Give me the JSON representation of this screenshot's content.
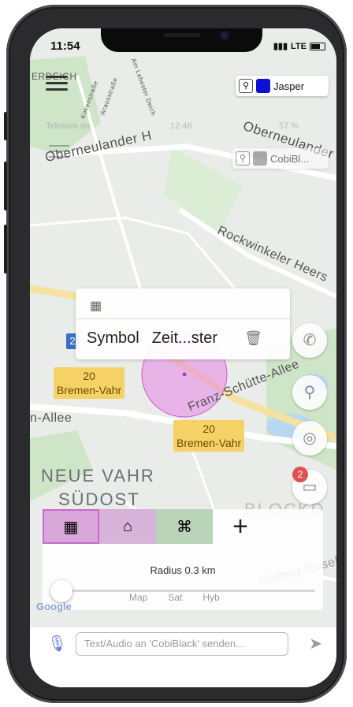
{
  "status": {
    "time": "11:54",
    "signal": "LTE"
  },
  "menu": {
    "icon": "hamburger-menu-icon"
  },
  "users": [
    {
      "name": "Jasper",
      "color": "#0b12d6"
    },
    {
      "name": "CobiBl...",
      "color": "#6e6e6e"
    }
  ],
  "ghost_status": {
    "carrier": "Telekom.de",
    "time": "12:46",
    "battery": "57 %"
  },
  "map": {
    "streets": [
      "Oberneulander H",
      "Oberneulander",
      "Rockwinkeler Heers",
      "Franz-Schütte-Allee",
      "n-Allee",
      "Ludwig-Rosel",
      "ERDEICH"
    ],
    "small_streets": [
      "Am Lehester Deich",
      "Kokenstraße",
      "Ikrausstraße"
    ],
    "districts": [
      "NEUE VAHR",
      "SÜDOST",
      "BLOCKD"
    ],
    "signs": [
      {
        "number": "20",
        "name": "Bremen-Vahr"
      },
      {
        "number": "20",
        "name": "Bremen-Vahr"
      }
    ],
    "route_marker": "2",
    "google": "Google"
  },
  "popup": {
    "symbol_label": "Symbol",
    "time_label": "Zeit...ster"
  },
  "fab_buttons": [
    "phone-forward-icon",
    "location-person-icon",
    "location-pin-icon",
    "chat-icon"
  ],
  "notification_count": "2",
  "sheet": {
    "categories": [
      {
        "icon": "office-building-icon",
        "bg": "#d9a7d9"
      },
      {
        "icon": "house-icon",
        "bg": "#d8b3d9"
      },
      {
        "icon": "24h-store-icon",
        "bg": "#b9d4b9"
      }
    ],
    "add": "+",
    "radius_text": "Radius 0.3 km",
    "map_types": [
      "Map",
      "Sat",
      "Hyb"
    ]
  },
  "input": {
    "placeholder": "Text/Audio an 'CobiBlack' senden..."
  }
}
